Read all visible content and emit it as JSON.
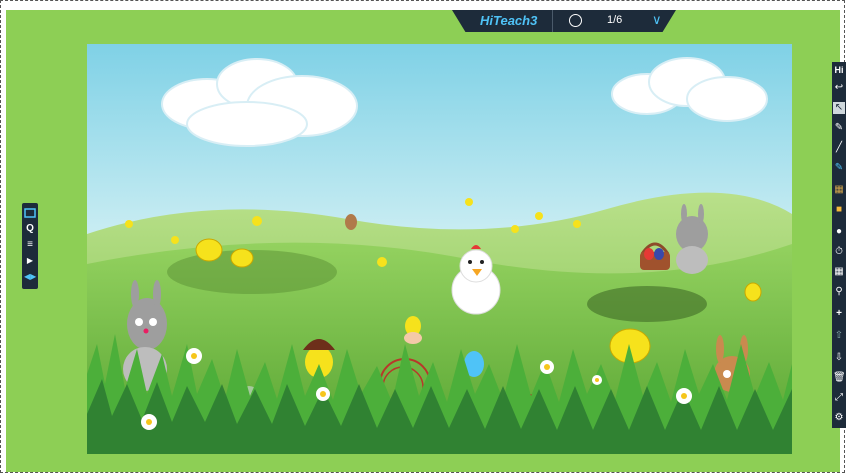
{
  "app": {
    "brand": "HiTeach",
    "brand_num": "3",
    "page_indicator": "1/6"
  },
  "left_toolbar": {
    "items": [
      "screen-icon",
      "q-icon",
      "menu-icon",
      "play-icon",
      "expand-icon"
    ]
  },
  "right_toolbar": {
    "header": "Hi",
    "items": [
      "undo-icon",
      "pointer-icon",
      "pen-icon",
      "line-icon",
      "highlighter-icon",
      "grid-icon",
      "stamp-icon",
      "people-icon",
      "timer-icon",
      "calendar-icon",
      "search-icon",
      "plus-icon",
      "upload-icon",
      "download-icon",
      "trash-icon",
      "fullscreen-icon",
      "settings-icon"
    ]
  },
  "colors": {
    "stage": "#8dcf55",
    "toolbar": "#1d2b3a",
    "accent": "#4fc3f7"
  }
}
